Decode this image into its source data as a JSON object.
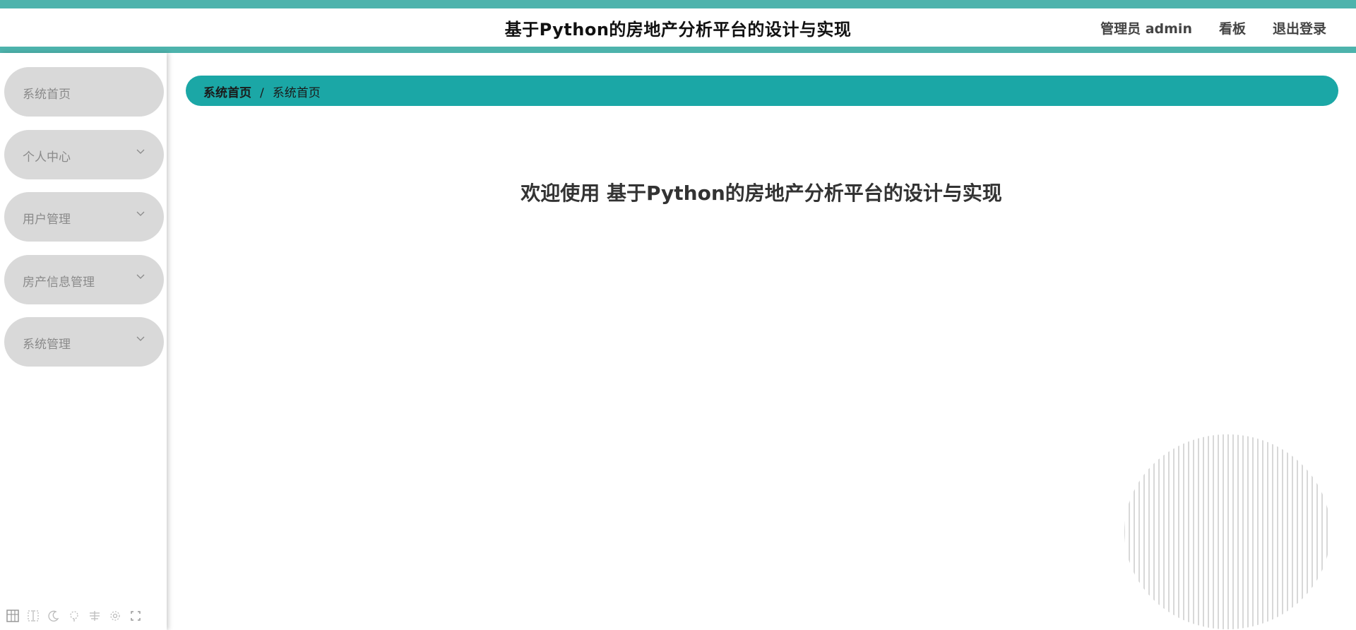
{
  "header": {
    "title": "基于Python的房地产分析平台的设计与实现",
    "user_label": "管理员 admin",
    "dashboard_label": "看板",
    "logout_label": "退出登录"
  },
  "sidebar": {
    "items": [
      {
        "label": "系统首页",
        "has_submenu": false
      },
      {
        "label": "个人中心",
        "has_submenu": true
      },
      {
        "label": "用户管理",
        "has_submenu": true
      },
      {
        "label": "房产信息管理",
        "has_submenu": true
      },
      {
        "label": "系统管理",
        "has_submenu": true
      }
    ]
  },
  "breadcrumb": {
    "first": "系统首页",
    "separator": "/",
    "current": "系统首页"
  },
  "main": {
    "welcome": "欢迎使用 基于Python的房地产分析平台的设计与实现"
  },
  "colors": {
    "accent": "#4db3ac",
    "breadcrumb_bg": "#1ba7a6",
    "menu_bg": "#d9d9d9"
  }
}
